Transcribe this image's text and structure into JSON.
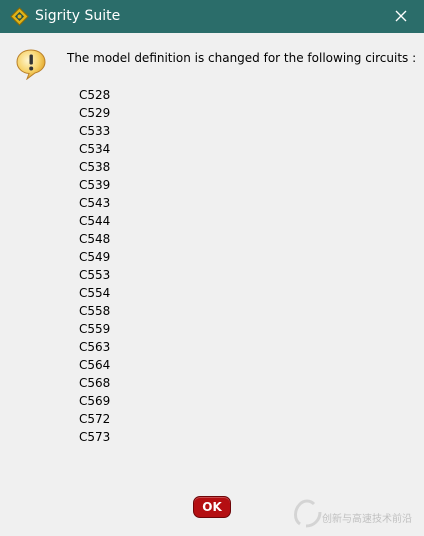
{
  "window": {
    "title": "Sigrity Suite",
    "app_icon": "sigrity-diamond-icon",
    "close_icon": "close-icon",
    "accent_color": "#2b6d6a"
  },
  "dialog": {
    "icon": "warning-icon",
    "message": "The model definition is changed for the following circuits :",
    "circuits": [
      "C528",
      "C529",
      "C533",
      "C534",
      "C538",
      "C539",
      "C543",
      "C544",
      "C548",
      "C549",
      "C553",
      "C554",
      "C558",
      "C559",
      "C563",
      "C564",
      "C568",
      "C569",
      "C572",
      "C573"
    ],
    "ok_label": "OK",
    "ok_color": "#b40f12"
  },
  "watermark": {
    "text": "创新与高速技术前沿"
  }
}
